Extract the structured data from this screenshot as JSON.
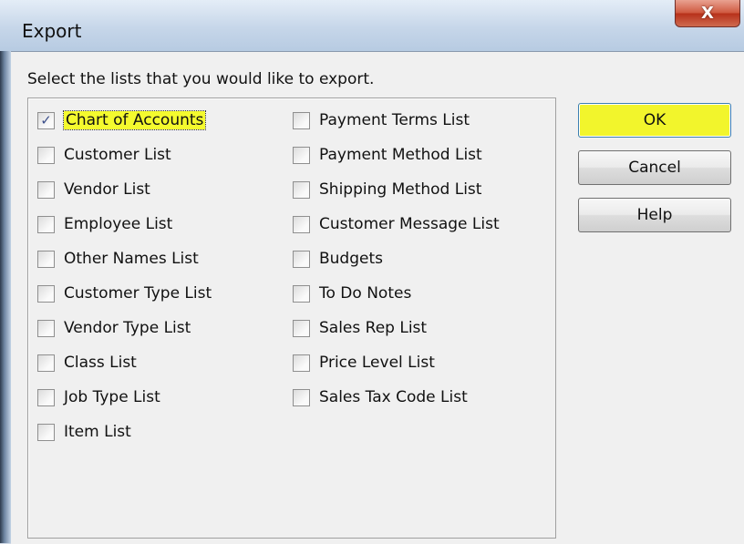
{
  "window": {
    "title": "Export",
    "close_glyph": "X"
  },
  "instruction": "Select the lists that you would like to export.",
  "column1": [
    {
      "label": "Chart of Accounts",
      "checked": true,
      "highlighted": true
    },
    {
      "label": "Customer List",
      "checked": false
    },
    {
      "label": "Vendor List",
      "checked": false
    },
    {
      "label": "Employee List",
      "checked": false
    },
    {
      "label": "Other Names List",
      "checked": false
    },
    {
      "label": "Customer Type List",
      "checked": false
    },
    {
      "label": "Vendor Type List",
      "checked": false
    },
    {
      "label": "Class List",
      "checked": false
    },
    {
      "label": "Job Type List",
      "checked": false
    },
    {
      "label": "Item List",
      "checked": false
    }
  ],
  "column2": [
    {
      "label": "Payment Terms List",
      "checked": false
    },
    {
      "label": "Payment Method List",
      "checked": false
    },
    {
      "label": "Shipping Method List",
      "checked": false
    },
    {
      "label": "Customer Message List",
      "checked": false
    },
    {
      "label": "Budgets",
      "checked": false
    },
    {
      "label": "To Do Notes",
      "checked": false
    },
    {
      "label": "Sales Rep List",
      "checked": false
    },
    {
      "label": "Price Level List",
      "checked": false
    },
    {
      "label": "Sales Tax Code List",
      "checked": false
    }
  ],
  "buttons": {
    "ok": "OK",
    "cancel": "Cancel",
    "help": "Help"
  },
  "colors": {
    "highlight": "#f4fa2e",
    "checkmark": "#3c4f8a"
  },
  "check_glyph": "✓"
}
